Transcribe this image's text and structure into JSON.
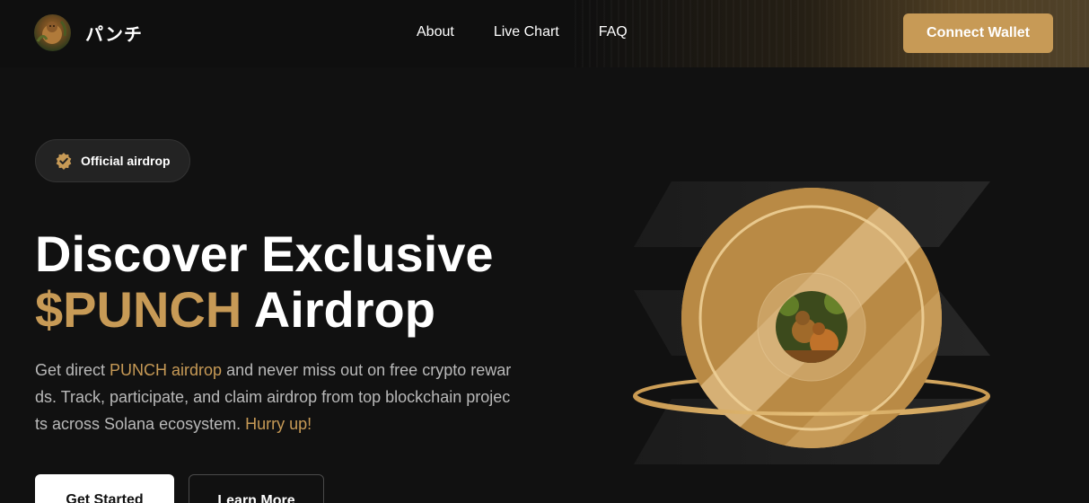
{
  "brand": {
    "logo_text": "パンチ",
    "logo_icon": "monkey-avatar-icon"
  },
  "nav": {
    "links": [
      "About",
      "Live Chart",
      "FAQ"
    ],
    "connect_label": "Connect Wallet"
  },
  "hero": {
    "badge_icon": "verified-badge-icon",
    "badge_text": "Official airdrop",
    "title_line1": "Discover Exclusive",
    "title_accent": "$PUNCH",
    "title_rest": " Airdrop",
    "desc_part1": "Get direct ",
    "desc_accent1": "PUNCH airdrop",
    "desc_part2": " and never miss out on free crypto rewards. Track, participate, and claim airdrop from top blockchain projects across Solana ecosystem. ",
    "desc_accent2": "Hurry up!",
    "primary_button": "Get Started",
    "secondary_button": "Learn More"
  },
  "art": {
    "coin_icon": "punch-coin-icon",
    "solana_icon": "solana-logo-icon"
  },
  "colors": {
    "accent": "#c79a56",
    "background": "#111111",
    "coin_light": "#d9b47a",
    "coin_dark": "#b98a45"
  }
}
